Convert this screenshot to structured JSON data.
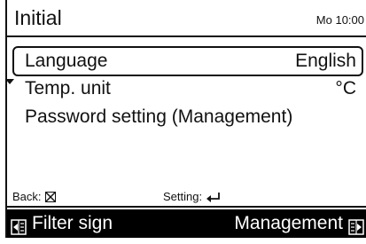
{
  "header": {
    "title": "Initial",
    "clock": "Mo 10:00"
  },
  "menu": {
    "items": [
      {
        "label": "Language",
        "value": "English"
      },
      {
        "label": "Temp. unit",
        "value": "°C"
      },
      {
        "label": "Password setting (Management)",
        "value": ""
      }
    ]
  },
  "hints": {
    "back": "Back:",
    "setting": "Setting:"
  },
  "footer": {
    "left_label": "Filter sign",
    "right_label": "Management"
  },
  "colors": {
    "foreground": "#111111",
    "background": "#ffffff",
    "footer_bg": "#000000"
  },
  "icons": {
    "back": "cancel-x-icon",
    "setting": "enter-return-icon",
    "footer_left": "menu-left-icon",
    "footer_right": "menu-right-icon"
  }
}
